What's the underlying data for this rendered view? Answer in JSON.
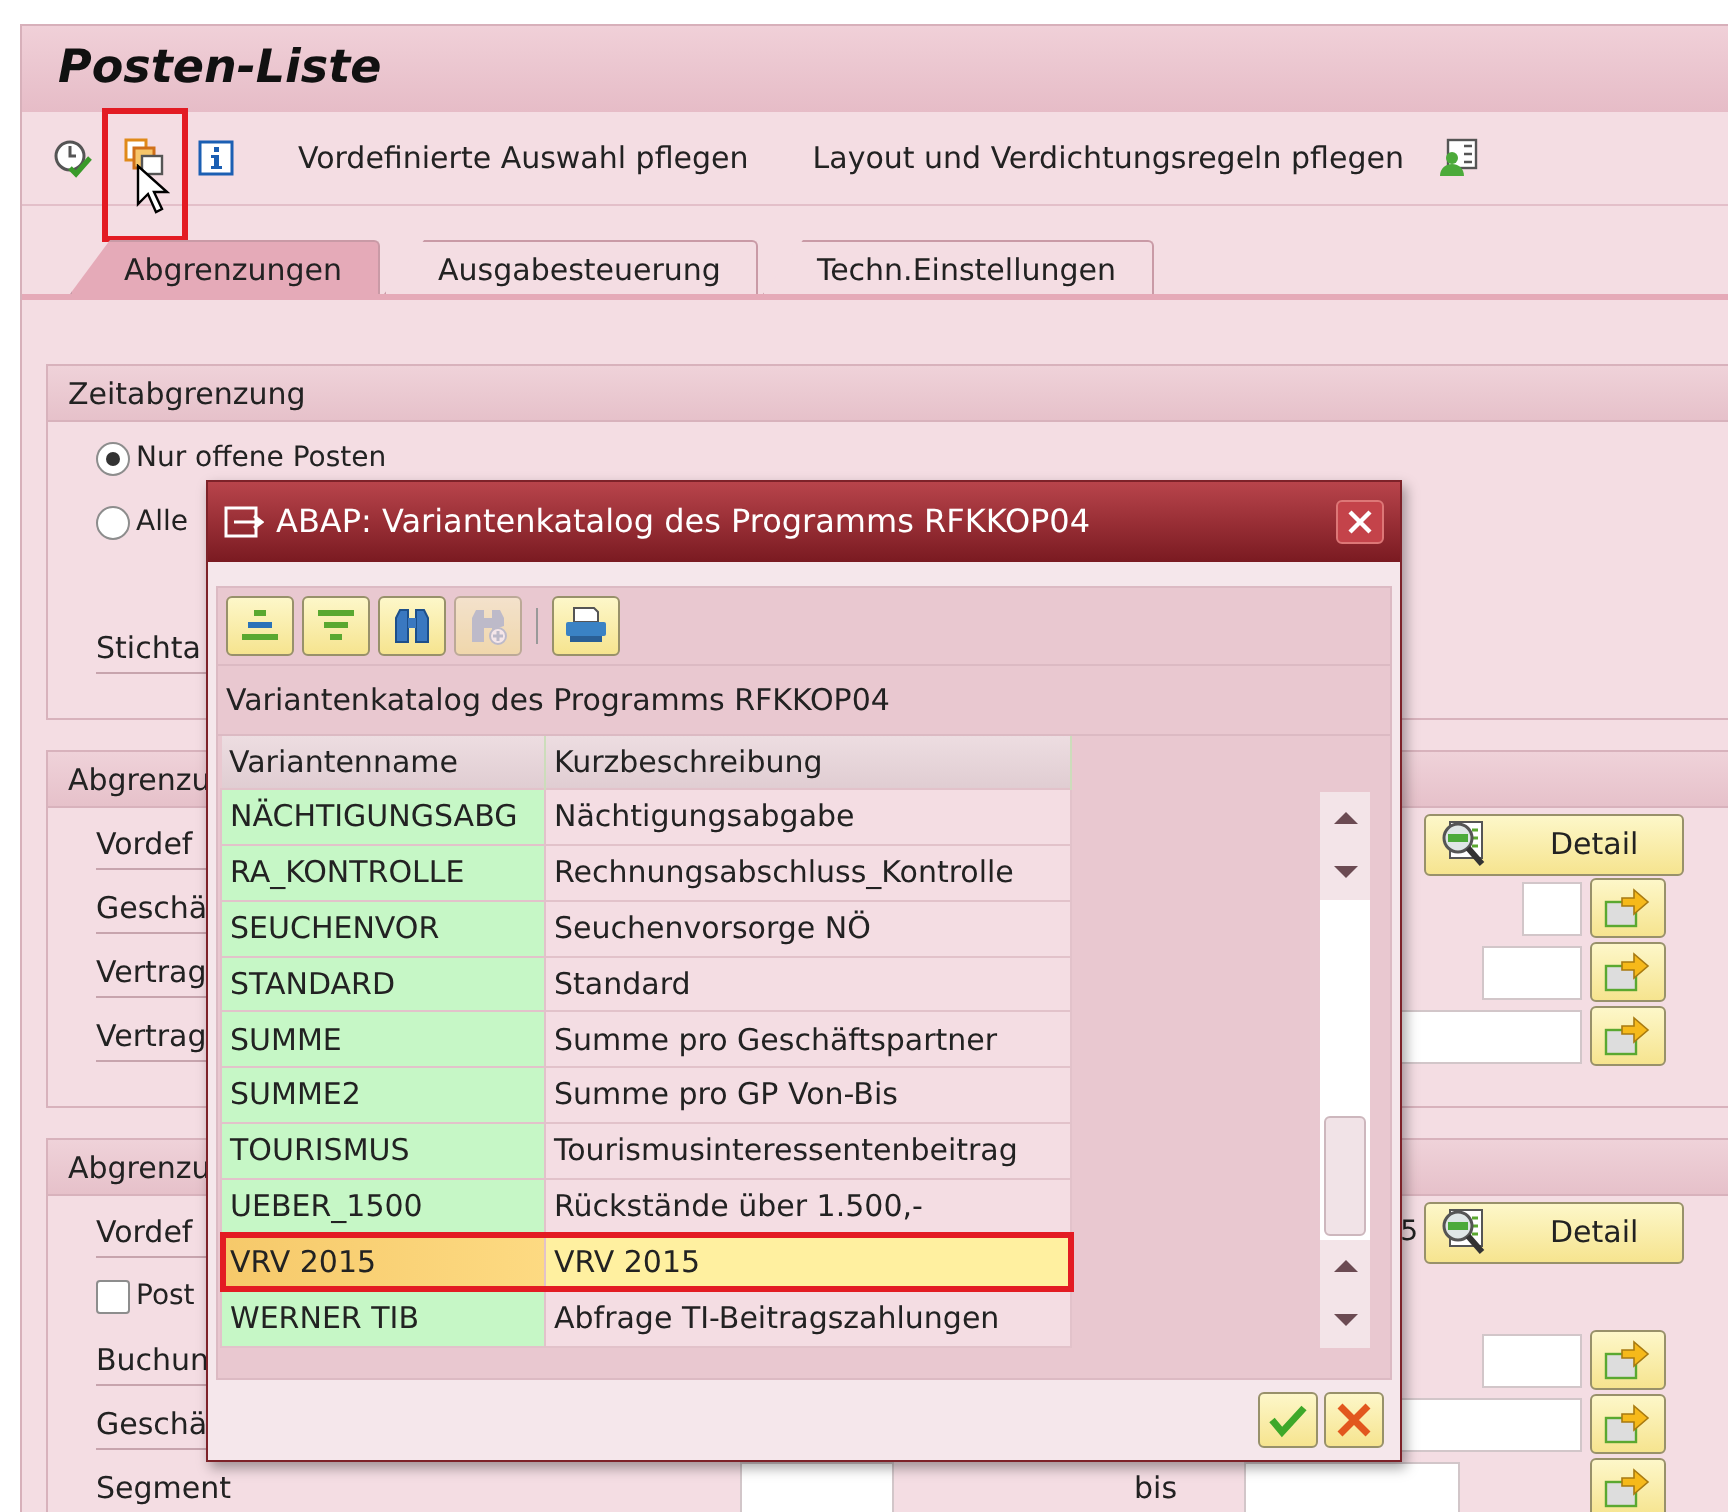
{
  "window": {
    "title": "Posten-Liste"
  },
  "toolbar": {
    "icon_buttons": [
      {
        "kind": "execute",
        "highlighted": false
      },
      {
        "kind": "variants",
        "highlighted": true
      },
      {
        "kind": "info",
        "highlighted": false
      }
    ],
    "text_buttons": [
      "Vordefinierte Auswahl pflegen",
      "Layout und Verdichtungsregeln pflegen"
    ],
    "end_buttons": [
      {
        "kind": "layout",
        "highlighted": false
      }
    ]
  },
  "tabs": [
    {
      "label": "Abgrenzungen",
      "selected": true
    },
    {
      "label": "Ausgabesteuerung",
      "selected": false
    },
    {
      "label": "Techn.Einstellungen",
      "selected": false
    }
  ],
  "groups": [
    {
      "title": "Zeitabgrenzung",
      "rows": [
        {
          "kind": "radio",
          "label": "Nur offene Posten",
          "selected": true
        },
        {
          "kind": "radio",
          "label": "Alle",
          "selected": false
        },
        {
          "kind": "spacer"
        },
        {
          "kind": "label",
          "label": "Stichta"
        }
      ]
    },
    {
      "title": "Abgrenzu",
      "rows": [
        {
          "kind": "detail",
          "label": "Vordef",
          "button": "Detail"
        },
        {
          "kind": "range",
          "label": "Geschä"
        },
        {
          "kind": "range",
          "label": "Vertrag"
        },
        {
          "kind": "range",
          "label": "Vertrag"
        }
      ]
    },
    {
      "title": "Abgrenzu",
      "rows": [
        {
          "kind": "detail",
          "label": "Vordef",
          "value": "5",
          "button": "Detail"
        },
        {
          "kind": "checkbox",
          "label": "Post",
          "checked": false
        },
        {
          "kind": "range",
          "label": "Buchun"
        },
        {
          "kind": "range",
          "label": "Geschä"
        },
        {
          "kind": "between",
          "label": "Segment",
          "between": "bis"
        }
      ]
    }
  ],
  "dialog": {
    "title": "ABAP: Variantenkatalog des Programms RFKKOP04",
    "tools": [
      {
        "kind": "sort-asc",
        "disabled": false
      },
      {
        "kind": "sort-desc",
        "disabled": false
      },
      {
        "kind": "find",
        "disabled": false
      },
      {
        "kind": "find-next",
        "disabled": true
      },
      {
        "kind": "print",
        "disabled": false
      }
    ],
    "caption": "Variantenkatalog des Programms RFKKOP04",
    "columns": [
      "Variantenname",
      "Kurzbeschreibung"
    ],
    "rows": [
      {
        "name": "NÄCHTIGUNGSABG",
        "description": "Nächtigungsabgabe",
        "selected": false
      },
      {
        "name": "RA_KONTROLLE",
        "description": "Rechnungsabschluss_Kontrolle",
        "selected": false
      },
      {
        "name": "SEUCHENVOR",
        "description": "Seuchenvorsorge NÖ",
        "selected": false
      },
      {
        "name": "STANDARD",
        "description": "Standard",
        "selected": false
      },
      {
        "name": "SUMME",
        "description": "Summe pro Geschäftspartner",
        "selected": false
      },
      {
        "name": "SUMME2",
        "description": "Summe pro GP Von-Bis",
        "selected": false
      },
      {
        "name": "TOURISMUS",
        "description": "Tourismusinteressentenbeitrag",
        "selected": false
      },
      {
        "name": "UEBER_1500",
        "description": "Rückstände über 1.500,-",
        "selected": false
      },
      {
        "name": "VRV 2015",
        "description": "VRV 2015",
        "selected": true
      },
      {
        "name": "WERNER TIB",
        "description": "Abfrage TI-Beitragszahlungen",
        "selected": false
      }
    ]
  }
}
